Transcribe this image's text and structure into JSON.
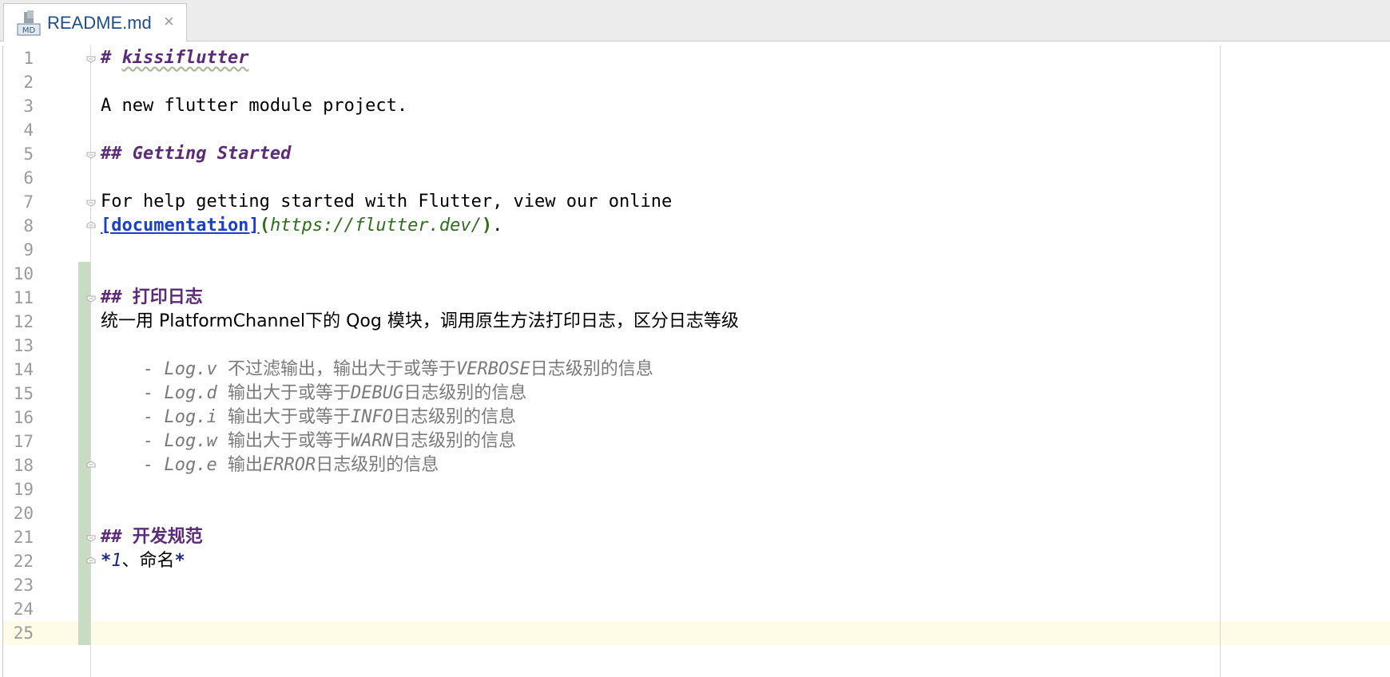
{
  "tab": {
    "filename": "README.md",
    "icon": "markdown-file-icon",
    "icon_badge": "MD",
    "close": "×"
  },
  "line_numbers": [
    "1",
    "2",
    "3",
    "4",
    "5",
    "6",
    "7",
    "8",
    "9",
    "10",
    "11",
    "12",
    "13",
    "14",
    "15",
    "16",
    "17",
    "18",
    "19",
    "20",
    "21",
    "22",
    "23",
    "24",
    "25"
  ],
  "lines": {
    "l1": {
      "marker": "# ",
      "text": "kissiflutter"
    },
    "l3": {
      "text": "A new flutter module project."
    },
    "l5": {
      "marker": "## ",
      "text": "Getting Started"
    },
    "l7": {
      "text": "For help getting started with Flutter, view our online"
    },
    "l8": {
      "link_text": "[documentation]",
      "open": "(",
      "url": "https://flutter.dev/",
      "close": ")",
      "tail": "."
    },
    "l11": {
      "marker": "## ",
      "text": "打印日志"
    },
    "l12": {
      "text": "统一用 PlatformChannel下的 Qog 模块，调用原生方法打印日志，区分日志等级"
    },
    "l14": {
      "prefix": "    - Log.v ",
      "text_a": "不过滤输出，输出大于或等于",
      "level": "VERBOSE",
      "text_b": "日志级别的信息"
    },
    "l15": {
      "prefix": "    - Log.d ",
      "text_a": "输出大于或等于",
      "level": "DEBUG",
      "text_b": "日志级别的信息"
    },
    "l16": {
      "prefix": "    - Log.i ",
      "text_a": "输出大于或等于",
      "level": "INFO",
      "text_b": "日志级别的信息"
    },
    "l17": {
      "prefix": "    - Log.w ",
      "text_a": "输出大于或等于",
      "level": "WARN",
      "text_b": "日志级别的信息"
    },
    "l18": {
      "prefix": "    - Log.e ",
      "text_a": "输出",
      "level": "ERROR",
      "text_b": "日志级别的信息"
    },
    "l21": {
      "marker": "## ",
      "text": "开发规范"
    },
    "l22": {
      "star_open": "*",
      "num": "1",
      "text": "、命名",
      "star_close": "*"
    }
  },
  "colors": {
    "heading": "#5b2a78",
    "link": "#1a3fc9",
    "url": "#2f6e1f",
    "list": "#7a7a7a",
    "emphasis": "#1b2a80",
    "current_line": "#fefbe6",
    "change_marker": "#c8dcc4"
  }
}
